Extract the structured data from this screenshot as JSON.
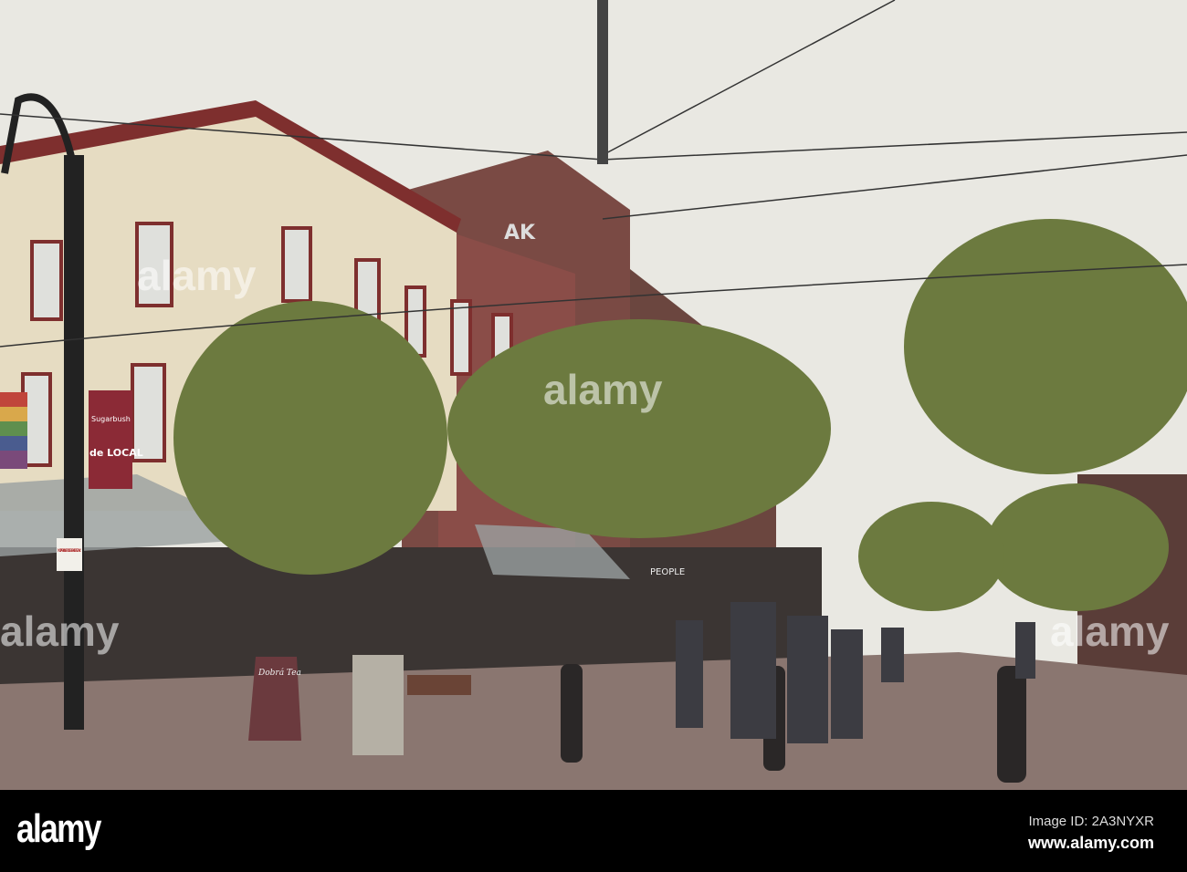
{
  "photo": {
    "signs": {
      "banner_top": "Sugarbush",
      "banner_main": "de LOCAL",
      "parking_sign": "NO PARKING POLICE VEHICLES ONLY",
      "sandwich_board": "Dobrá Tea",
      "building_letters": "AK",
      "storefront": "PEOPLE"
    },
    "watermarks": [
      "alamy",
      "alamy",
      "alamy",
      "alamy"
    ]
  },
  "footer": {
    "logo": "alamy",
    "image_id": "Image ID: 2A3NYXR",
    "website": "www.alamy.com"
  }
}
